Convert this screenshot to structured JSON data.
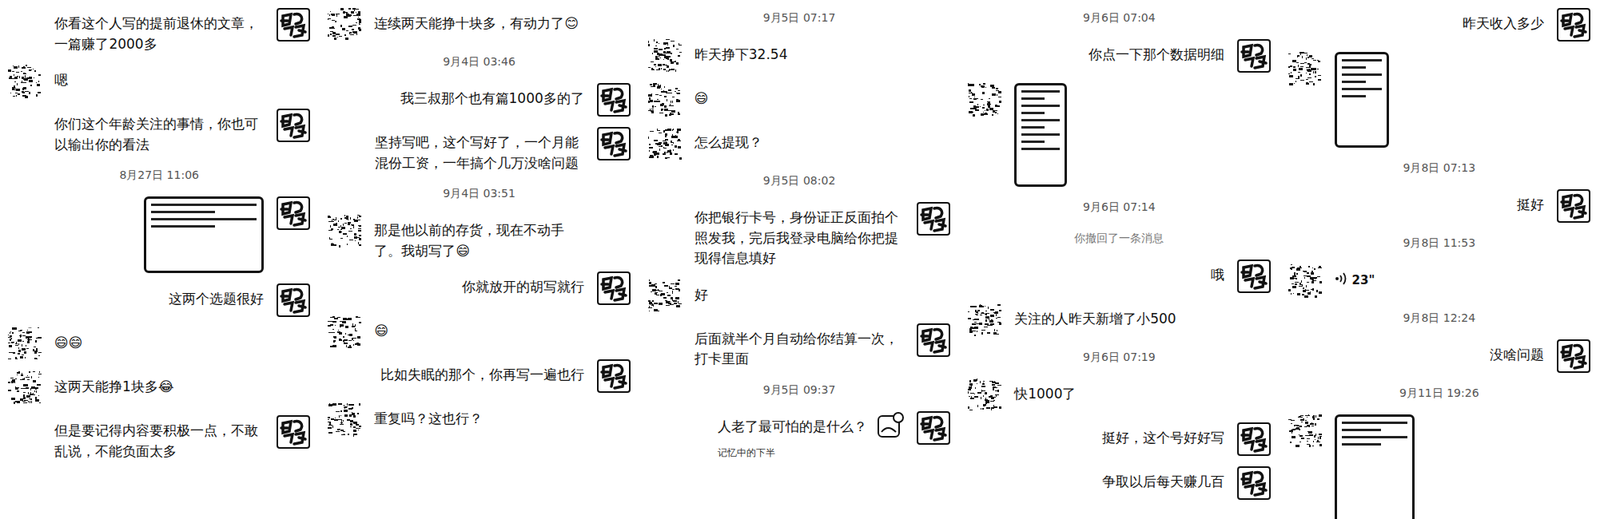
{
  "columns": [
    {
      "messages": [
        {
          "kind": "text",
          "side": "right",
          "text": "你看这个人写的提前退休的文章，一篇赚了2000多"
        },
        {
          "kind": "text",
          "side": "left",
          "text": "嗯"
        },
        {
          "kind": "text",
          "side": "right",
          "text": "你们这个年龄关注的事情，你也可以输出你的看法"
        },
        {
          "kind": "time",
          "text": "8月27日 11:06"
        },
        {
          "kind": "image",
          "side": "right"
        },
        {
          "kind": "text",
          "side": "right",
          "text": "这两个选题很好"
        },
        {
          "kind": "text",
          "side": "left",
          "text": "😄😄"
        },
        {
          "kind": "text",
          "side": "left",
          "text": "这两天能挣1块多😂"
        },
        {
          "kind": "text",
          "side": "right",
          "text": "但是要记得内容要积极一点，不敢乱说，不能负面太多"
        }
      ]
    },
    {
      "messages": [
        {
          "kind": "text",
          "side": "left",
          "text": "连续两天能挣十块多，有动力了😊"
        },
        {
          "kind": "time",
          "text": "9月4日 03:46"
        },
        {
          "kind": "text",
          "side": "right",
          "text": "我三叔那个也有篇1000多的了"
        },
        {
          "kind": "text",
          "side": "right",
          "text": "坚持写吧，这个写好了，一个月能混份工资，一年搞个几万没啥问题"
        },
        {
          "kind": "time",
          "text": "9月4日 03:51"
        },
        {
          "kind": "text",
          "side": "left",
          "text": "那是他以前的存货，现在不动手了。我胡写了😄"
        },
        {
          "kind": "text",
          "side": "right",
          "text": "你就放开的胡写就行"
        },
        {
          "kind": "text",
          "side": "left",
          "text": "😄"
        },
        {
          "kind": "text",
          "side": "right",
          "text": "比如失眠的那个，你再写一遍也行"
        },
        {
          "kind": "text",
          "side": "left",
          "text": "重复吗？这也行？"
        }
      ]
    },
    {
      "messages": [
        {
          "kind": "time",
          "text": "9月5日 07:17"
        },
        {
          "kind": "text",
          "side": "left",
          "text": "昨天挣下32.54"
        },
        {
          "kind": "text",
          "side": "left",
          "text": "😄"
        },
        {
          "kind": "text",
          "side": "left",
          "text": "怎么提现？"
        },
        {
          "kind": "time",
          "text": "9月5日 08:02"
        },
        {
          "kind": "text",
          "side": "right",
          "text": "你把银行卡号，身份证正反面拍个照发我，完后我登录电脑给你把提现得信息填好"
        },
        {
          "kind": "text",
          "side": "left",
          "text": "好"
        },
        {
          "kind": "text",
          "side": "right",
          "text": "后面就半个月自动给你结算一次，打卡里面"
        },
        {
          "kind": "time",
          "text": "9月5日 09:37"
        },
        {
          "kind": "link",
          "side": "right",
          "text": "人老了最可怕的是什么？",
          "source": "记忆中的下半"
        }
      ]
    },
    {
      "messages": [
        {
          "kind": "time",
          "text": "9月6日 07:04"
        },
        {
          "kind": "text",
          "side": "right",
          "text": "你点一下那个数据明细"
        },
        {
          "kind": "image",
          "side": "left"
        },
        {
          "kind": "time",
          "text": "9月6日 07:14"
        },
        {
          "kind": "system",
          "text": "你撤回了一条消息"
        },
        {
          "kind": "text",
          "side": "right",
          "text": "哦"
        },
        {
          "kind": "text",
          "side": "left",
          "text": "关注的人昨天新增了小500"
        },
        {
          "kind": "time",
          "text": "9月6日 07:19"
        },
        {
          "kind": "text",
          "side": "left",
          "text": "快1000了"
        },
        {
          "kind": "text",
          "side": "right",
          "text": "挺好，这个号好好写"
        },
        {
          "kind": "text",
          "side": "right",
          "text": "争取以后每天赚几百"
        }
      ]
    },
    {
      "messages": [
        {
          "kind": "text",
          "side": "right",
          "text": "昨天收入多少"
        },
        {
          "kind": "image",
          "side": "left"
        },
        {
          "kind": "time",
          "text": "9月8日 07:13"
        },
        {
          "kind": "text",
          "side": "right",
          "text": "挺好"
        },
        {
          "kind": "time",
          "text": "9月8日 11:53"
        },
        {
          "kind": "voice",
          "side": "left",
          "text": "23\""
        },
        {
          "kind": "time",
          "text": "9月8日 12:24"
        },
        {
          "kind": "text",
          "side": "right",
          "text": "没啥问题"
        },
        {
          "kind": "time",
          "text": "9月11日 19:26"
        },
        {
          "kind": "image",
          "side": "left"
        }
      ]
    }
  ]
}
